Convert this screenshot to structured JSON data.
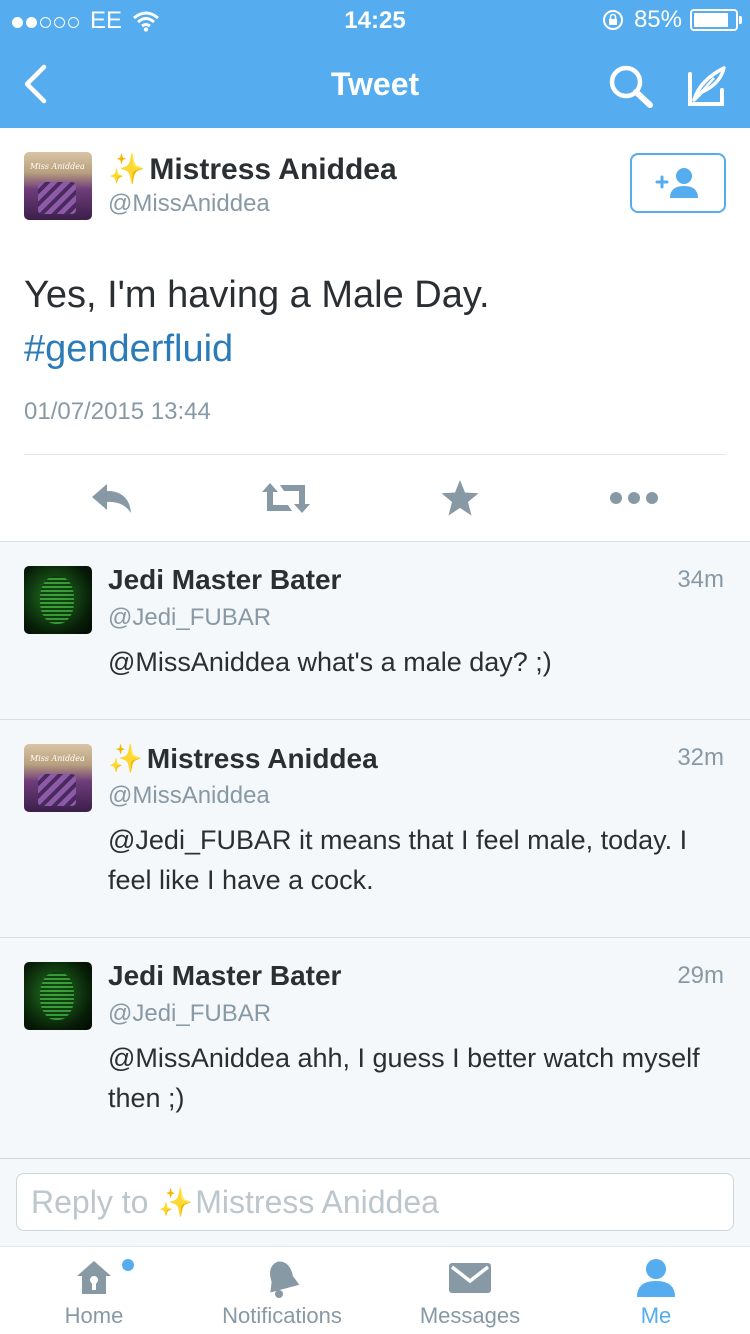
{
  "status_bar": {
    "carrier": "EE",
    "time": "14:25",
    "battery": "85%",
    "battery_level": 0.85
  },
  "nav": {
    "title": "Tweet"
  },
  "main_tweet": {
    "name": "Mistress Aniddea",
    "handle": "@MissAniddea",
    "text": "Yes, I'm having a Male Day.",
    "hashtag": "#genderfluid",
    "date": "01/07/2015 13:44"
  },
  "replies": [
    {
      "name": "Jedi Master Bater",
      "handle": "@Jedi_FUBAR",
      "time": "34m",
      "text": "@MissAniddea what's a male day? ;)"
    },
    {
      "name": "Mistress Aniddea",
      "handle": "@MissAniddea",
      "time": "32m",
      "text": "@Jedi_FUBAR it means that I feel male, today. I feel like I have a cock."
    },
    {
      "name": "Jedi Master Bater",
      "handle": "@Jedi_FUBAR",
      "time": "29m",
      "text": "@MissAniddea ahh, I guess I better watch myself then ;)"
    }
  ],
  "reply_bar": {
    "prefix": "Reply to",
    "target": "Mistress Aniddea"
  },
  "tabs": [
    {
      "label": "Home",
      "icon": "home-icon"
    },
    {
      "label": "Notifications",
      "icon": "bell-icon"
    },
    {
      "label": "Messages",
      "icon": "envelope-icon"
    },
    {
      "label": "Me",
      "icon": "person-icon"
    }
  ],
  "colors": {
    "brand": "#55acee",
    "link": "#2b7bb9",
    "sparkle": "#f5b800"
  }
}
